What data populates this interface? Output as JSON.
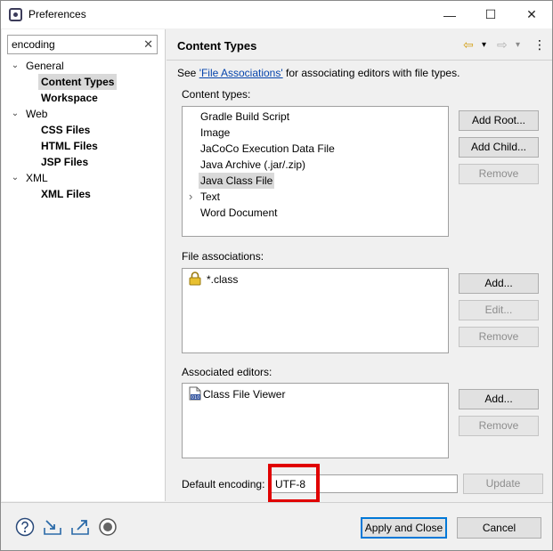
{
  "window": {
    "title": "Preferences",
    "minimize_glyph": "—",
    "maximize_glyph": "☐",
    "close_glyph": "✕"
  },
  "filter": {
    "value": "encoding",
    "clear_glyph": "✕"
  },
  "tree": {
    "general": "General",
    "content_types": "Content Types",
    "workspace": "Workspace",
    "web": "Web",
    "css_files": "CSS Files",
    "html_files": "HTML Files",
    "jsp_files": "JSP Files",
    "xml": "XML",
    "xml_files": "XML Files",
    "expanded_glyph": "⌄"
  },
  "page": {
    "title": "Content Types",
    "see_prefix": "See ",
    "see_link": "'File Associations'",
    "see_suffix": " for associating editors with file types.",
    "nav_back_glyph": "⇦",
    "nav_forward_glyph": "⇨",
    "dropdown_glyph": "▾",
    "menu_glyph": "⋮"
  },
  "content_types": {
    "label": "Content types:",
    "items": [
      "Gradle Build Script",
      "Image",
      "JaCoCo Execution Data File",
      "Java Archive (.jar/.zip)",
      "Java Class File",
      "Text",
      "Word Document"
    ],
    "selected": "Java Class File",
    "collapsed_glyph": "›",
    "add_root": "Add Root...",
    "add_child": "Add Child...",
    "remove": "Remove"
  },
  "file_associations": {
    "label": "File associations:",
    "items": [
      "*.class"
    ],
    "add": "Add...",
    "edit": "Edit...",
    "remove": "Remove"
  },
  "associated_editors": {
    "label": "Associated editors:",
    "items": [
      "Class File Viewer"
    ],
    "editor_icon_text": "010",
    "add": "Add...",
    "remove": "Remove"
  },
  "encoding": {
    "label": "Default encoding:",
    "value": "UTF-8",
    "update": "Update"
  },
  "footer": {
    "apply_close": "Apply and Close",
    "cancel": "Cancel"
  },
  "icons": {
    "help": "help-icon",
    "import": "import-icon",
    "export": "export-icon",
    "record": "record-icon",
    "lock": "lock-icon",
    "editor": "class-file-editor-icon"
  },
  "colors": {
    "highlight": "#e00000",
    "link": "#0645ad",
    "selection": "#d9d9d9"
  }
}
